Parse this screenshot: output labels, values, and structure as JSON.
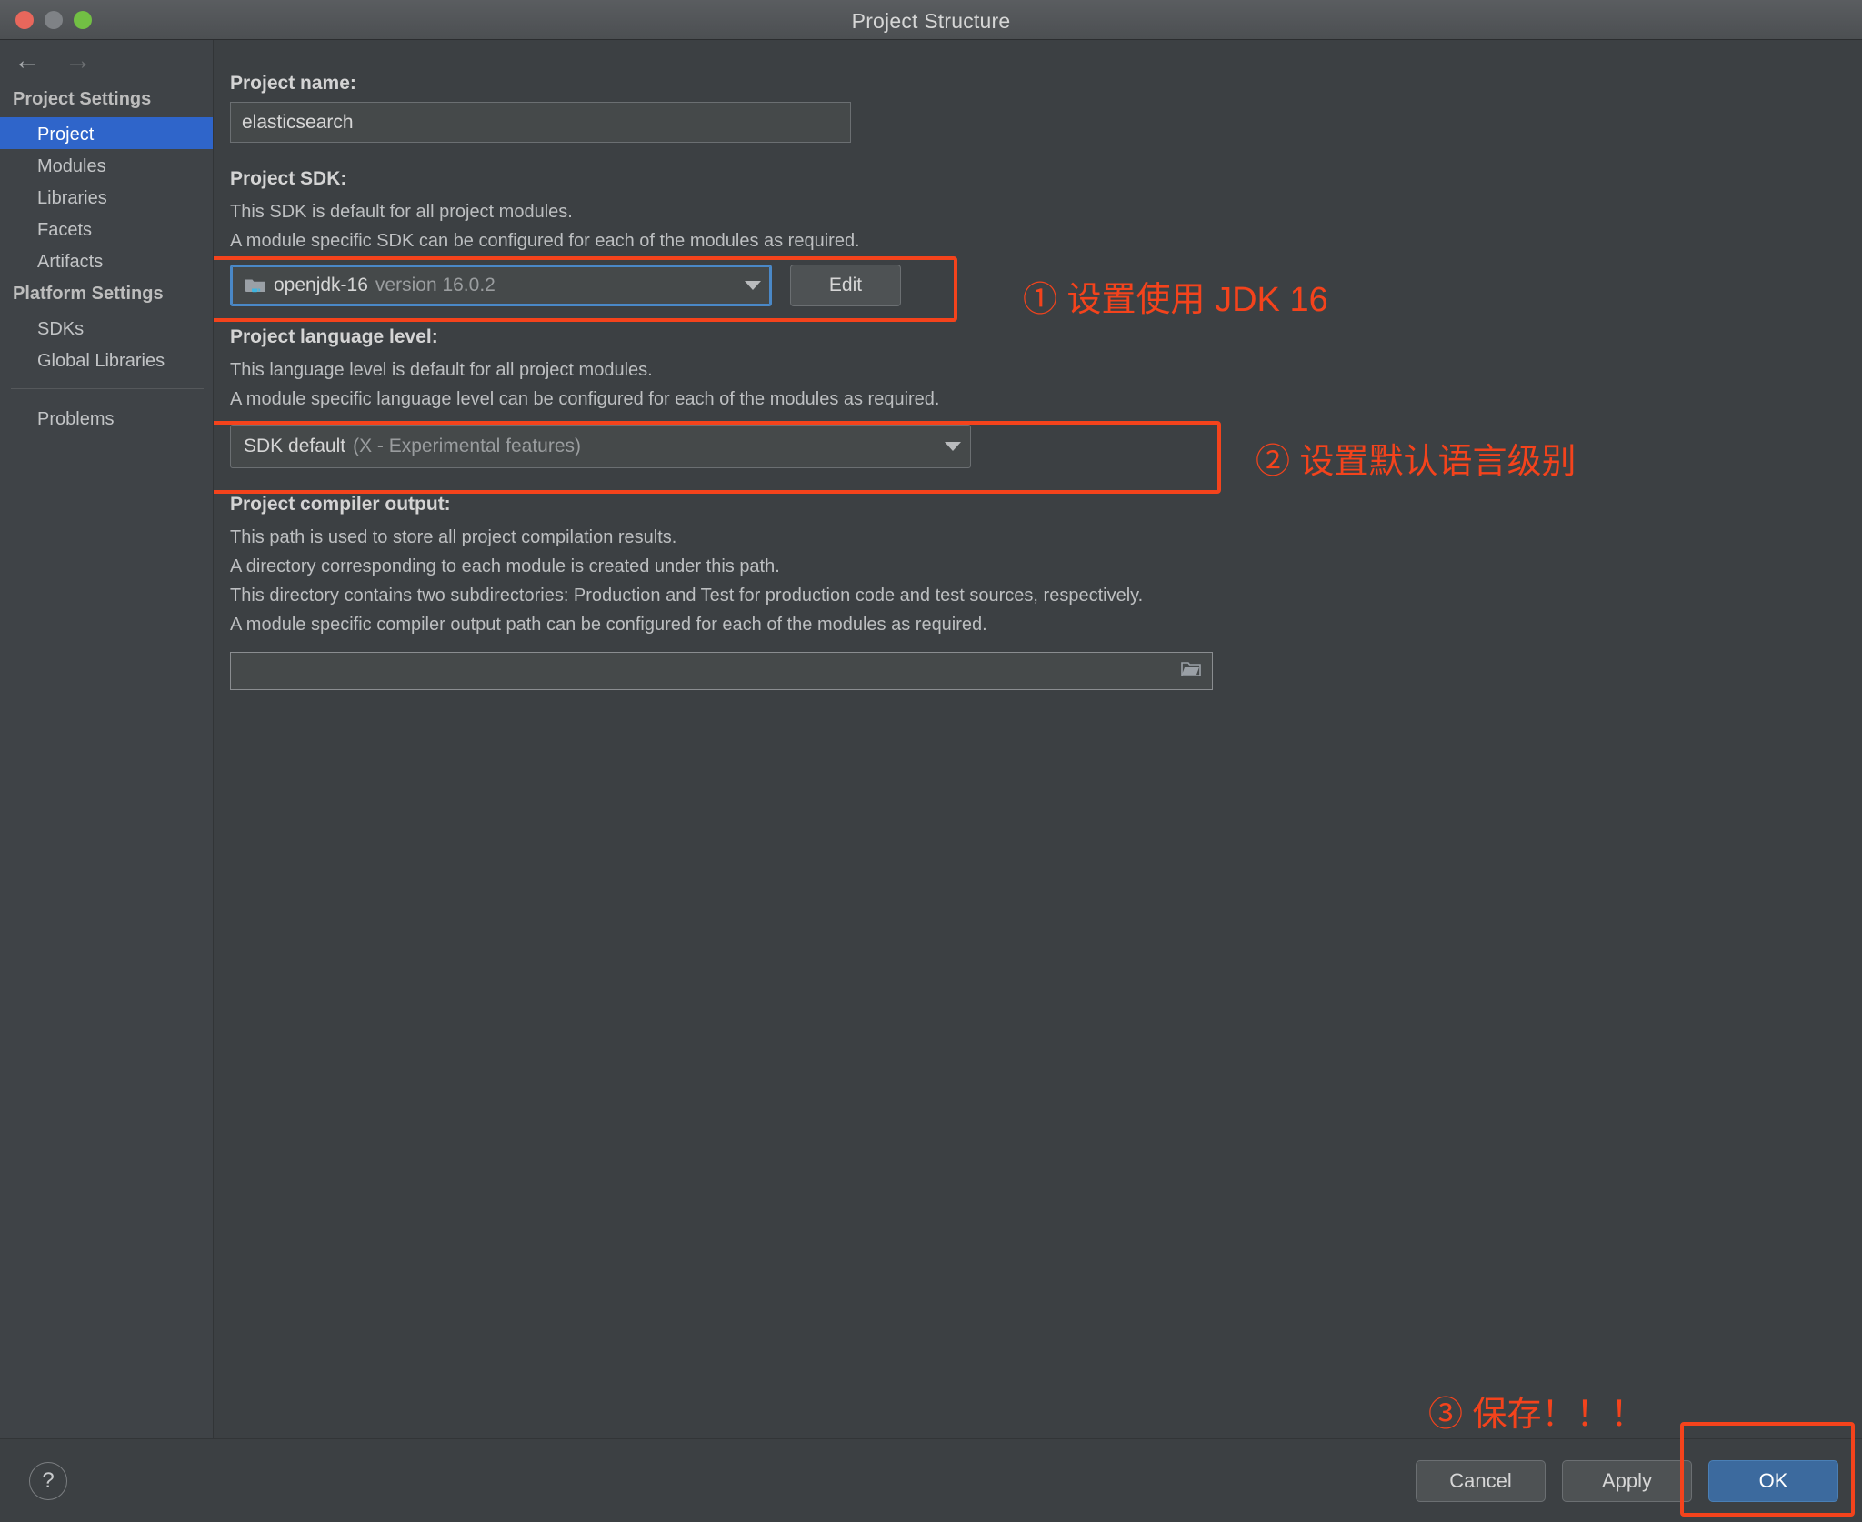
{
  "window": {
    "title": "Project Structure",
    "traffic_lights": [
      "close-red",
      "minimize-gray",
      "maximize-green"
    ]
  },
  "nav": {
    "back_icon": "←",
    "forward_icon": "→",
    "groups": [
      {
        "title": "Project Settings",
        "items": [
          {
            "label": "Project",
            "selected": true
          },
          {
            "label": "Modules",
            "selected": false
          },
          {
            "label": "Libraries",
            "selected": false
          },
          {
            "label": "Facets",
            "selected": false
          },
          {
            "label": "Artifacts",
            "selected": false
          }
        ]
      },
      {
        "title": "Platform Settings",
        "items": [
          {
            "label": "SDKs",
            "selected": false
          },
          {
            "label": "Global Libraries",
            "selected": false
          }
        ]
      }
    ],
    "problems_label": "Problems"
  },
  "main": {
    "project_name": {
      "label": "Project name:",
      "value": "elasticsearch",
      "placeholder": "Project name"
    },
    "project_sdk": {
      "label": "Project SDK:",
      "desc1": "This SDK is default for all project modules.",
      "desc2": "A module specific SDK can be configured for each of the modules as required.",
      "value_name": "openjdk-16",
      "value_version": "version 16.0.2",
      "edit_label": "Edit"
    },
    "language_level": {
      "label": "Project language level:",
      "desc1": "This language level is default for all project modules.",
      "desc2": "A module specific language level can be configured for each of the modules as required.",
      "value_name": "SDK default",
      "value_detail": "(X - Experimental features)"
    },
    "compiler_output": {
      "label": "Project compiler output:",
      "desc1": "This path is used to store all project compilation results.",
      "desc2": "A directory corresponding to each module is created under this path.",
      "desc3": "This directory contains two subdirectories: Production and Test for production code and test sources, respectively.",
      "desc4": "A module specific compiler output path can be configured for each of the modules as required.",
      "value": "",
      "placeholder": ""
    }
  },
  "annotations": {
    "color": "#f4431c",
    "items": [
      {
        "text": "① 设置使用 JDK 16"
      },
      {
        "text": "② 设置默认语言级别"
      },
      {
        "text": "③ 保存！！！"
      }
    ]
  },
  "footer": {
    "help_label": "?",
    "cancel_label": "Cancel",
    "apply_label": "Apply",
    "ok_label": "OK"
  },
  "colors": {
    "accent_selected": "#2f65ca",
    "primary_button": "#3c6a9e",
    "annotation_red": "#f4431c",
    "window_bg": "#3c4043",
    "sidebar_bg": "#3f4347"
  }
}
